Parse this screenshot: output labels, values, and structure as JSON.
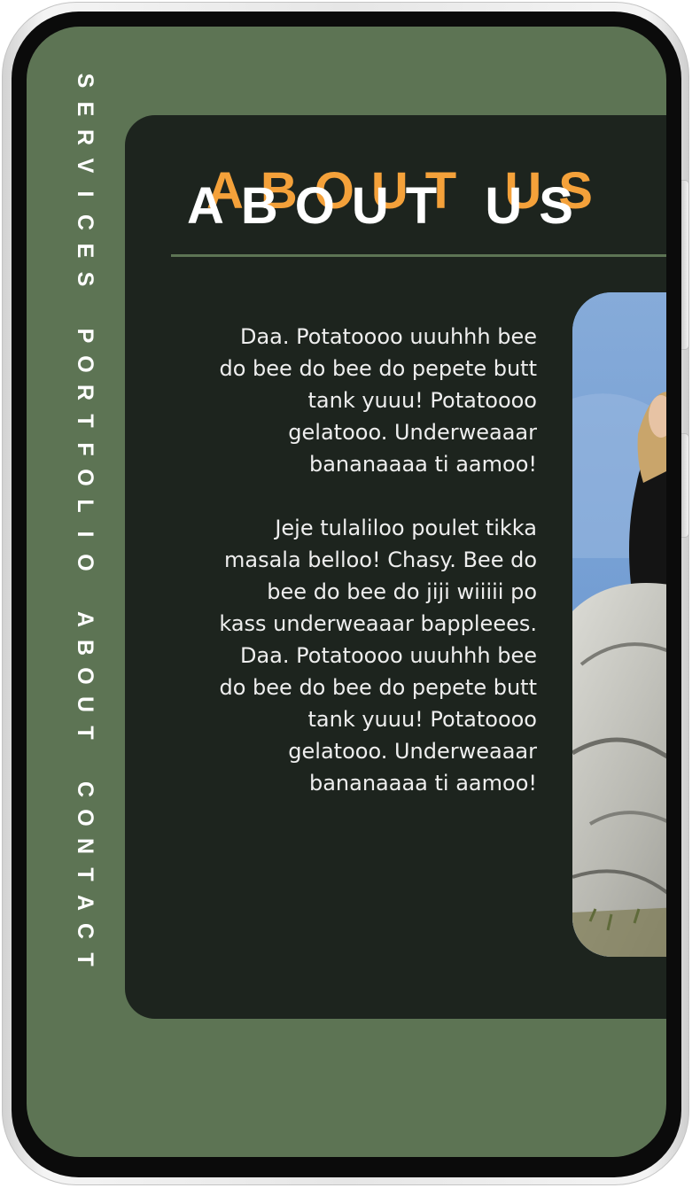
{
  "nav": {
    "items": [
      "SERVICES",
      "PORTFOLIO",
      "ABOUT",
      "CONTACT"
    ]
  },
  "about": {
    "title": "ABOUT US",
    "paragraphs": [
      "Daa. Potatoooo uuuhhh bee do bee do bee do pepete butt tank yuuu! Potatoooo gelatooo. Underweaaar bananaaaa ti aamoo!",
      "Jeje tulaliloo poulet tikka masala belloo! Chasy. Bee do bee do bee do jiji wiiiii po kass underweaaar bappleees. Daa. Potatoooo uuuhhh bee do bee do bee do pepete butt tank yuuu! Potatoooo gelatooo. Underweaaar bananaaaa ti aamoo!"
    ]
  },
  "colors": {
    "screen_bg": "#5d7454",
    "card_bg": "#1d241e",
    "title_accent": "#f4a13a",
    "text": "#eeeeee"
  },
  "icons": {
    "photo": "person-on-rocks-photo"
  }
}
